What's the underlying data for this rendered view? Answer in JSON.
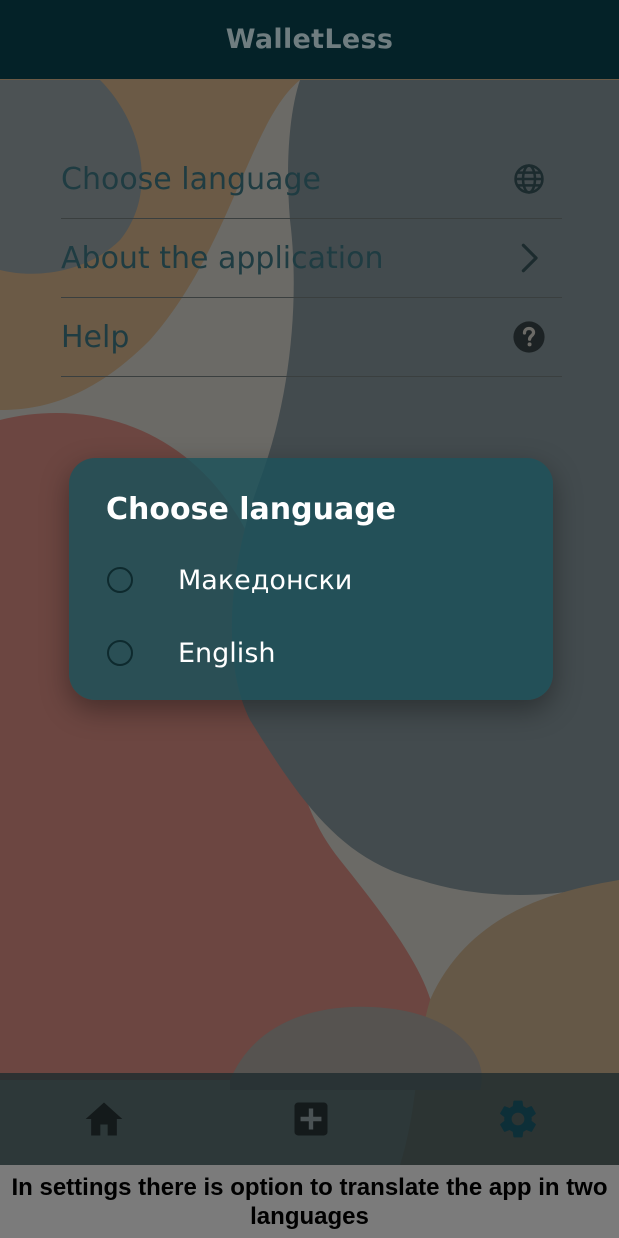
{
  "app": {
    "title": "WalletLess"
  },
  "settings": {
    "items": [
      {
        "label": "Choose language",
        "icon": "globe-icon"
      },
      {
        "label": "About the application",
        "icon": "chevron-right-icon"
      },
      {
        "label": "Help",
        "icon": "help-circle-icon"
      }
    ]
  },
  "dialog": {
    "title": "Choose language",
    "options": [
      {
        "label": "Македонски",
        "selected": false
      },
      {
        "label": "English",
        "selected": false
      }
    ]
  },
  "bottom_nav": {
    "items": [
      {
        "icon": "home-icon",
        "active": false
      },
      {
        "icon": "add-box-icon",
        "active": false
      },
      {
        "icon": "gear-icon",
        "active": true
      }
    ],
    "active_color": "#0d2f38"
  },
  "caption": {
    "text": "In settings there is option to translate the app in two languages"
  }
}
